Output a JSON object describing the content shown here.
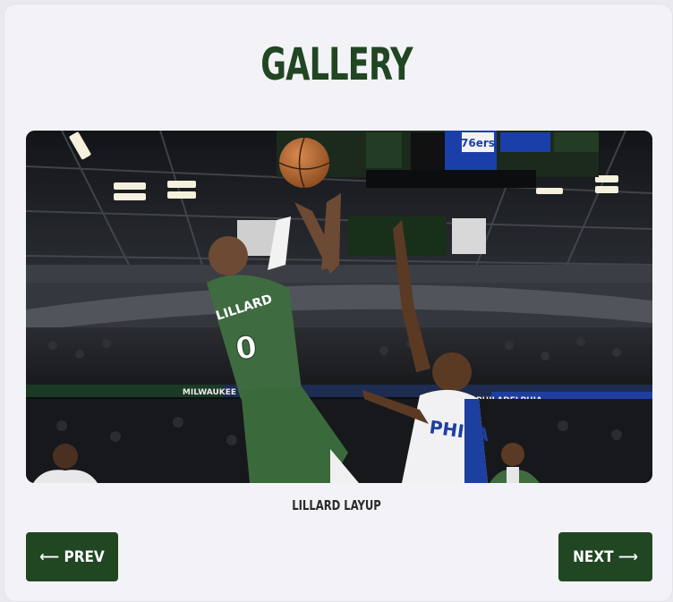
{
  "gallery": {
    "title": "GALLERY",
    "image": {
      "caption": "LILLARD LAYUP",
      "player_name": "LILLARD",
      "player_number": "0",
      "defender_team_text": "PHILA",
      "scoreboard_team": "76ers",
      "banner_left": "MILWAUKEE",
      "banner_right": "PHILADELPHIA"
    },
    "nav": {
      "prev_label": "⟵ PREV",
      "next_label": "NEXT ⟶"
    }
  }
}
